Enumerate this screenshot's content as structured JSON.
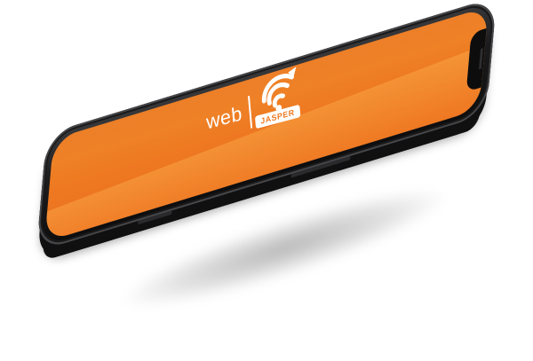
{
  "device": {
    "type": "smartphone",
    "screen_color": "#ee7a22",
    "frame_color": "#1c1c1e"
  },
  "logo": {
    "word": "web",
    "badge": "JASPER",
    "icon": "wifi-icon",
    "color": "#ffffff"
  }
}
